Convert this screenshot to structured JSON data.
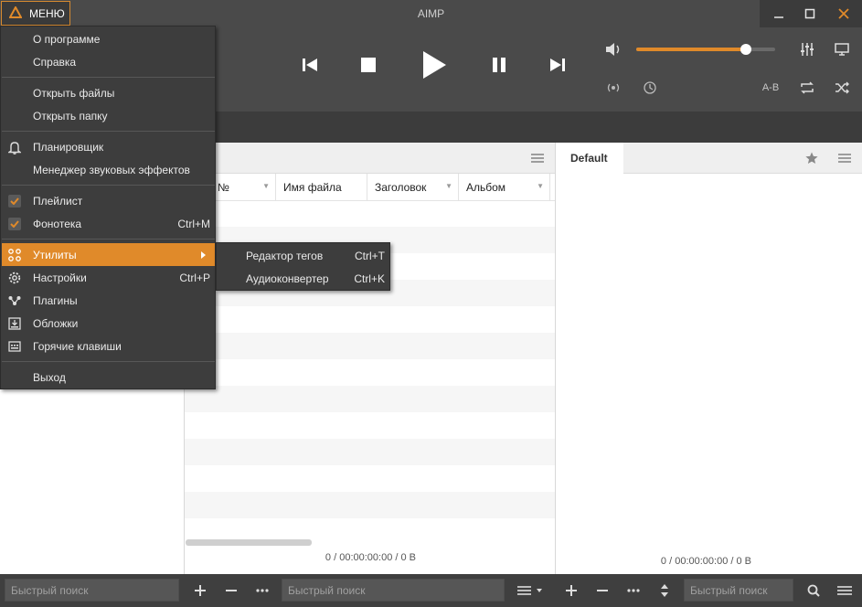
{
  "window": {
    "title": "AIMP",
    "menu_label": "МЕНЮ",
    "controls": [
      "minimize-icon",
      "maximize-icon",
      "close-icon"
    ]
  },
  "player": {
    "transport": [
      "previous-icon",
      "stop-icon",
      "play-icon",
      "pause-icon",
      "next-icon"
    ],
    "volume_level": 0.79,
    "ab_label": "A-B",
    "accent_color": "#e08a2a"
  },
  "menu": {
    "items": [
      {
        "label": "О программе",
        "shortcut": "",
        "icon": ""
      },
      {
        "label": "Справка",
        "shortcut": "",
        "icon": ""
      },
      {
        "label": "Открыть файлы",
        "shortcut": "",
        "icon": ""
      },
      {
        "label": "Открыть папку",
        "shortcut": "",
        "icon": ""
      },
      {
        "label": "Планировщик",
        "shortcut": "",
        "icon": "bell-icon"
      },
      {
        "label": "Менеджер звуковых эффектов",
        "shortcut": "",
        "icon": ""
      },
      {
        "label": "Плейлист",
        "shortcut": "",
        "icon": "checkbox-checked-icon"
      },
      {
        "label": "Фонотека",
        "shortcut": "Ctrl+M",
        "icon": "checkbox-checked-icon"
      },
      {
        "label": "Утилиты",
        "shortcut": "",
        "icon": "utilities-icon"
      },
      {
        "label": "Настройки",
        "shortcut": "Ctrl+P",
        "icon": "gear-icon"
      },
      {
        "label": "Плагины",
        "shortcut": "",
        "icon": "plugins-icon"
      },
      {
        "label": "Обложки",
        "shortcut": "",
        "icon": "covers-icon"
      },
      {
        "label": "Горячие клавиши",
        "shortcut": "",
        "icon": "keyboard-icon"
      },
      {
        "label": "Выход",
        "shortcut": "",
        "icon": ""
      }
    ],
    "submenu": [
      {
        "label": "Редактор тегов",
        "shortcut": "Ctrl+T"
      },
      {
        "label": "Аудиоконвертер",
        "shortcut": "Ctrl+K"
      }
    ]
  },
  "playlist": {
    "columns": [
      "№",
      "Имя файла",
      "Заголовок",
      "Альбом"
    ],
    "status": "0 / 00:00:00:00 / 0 B"
  },
  "right_panel": {
    "tab": "Default",
    "status": "0 / 00:00:00:00 / 0 B"
  },
  "bottom": {
    "search_placeholder_1": "Быстрый поиск",
    "search_placeholder_2": "Быстрый поиск",
    "search_placeholder_3": "Быстрый поиск"
  }
}
